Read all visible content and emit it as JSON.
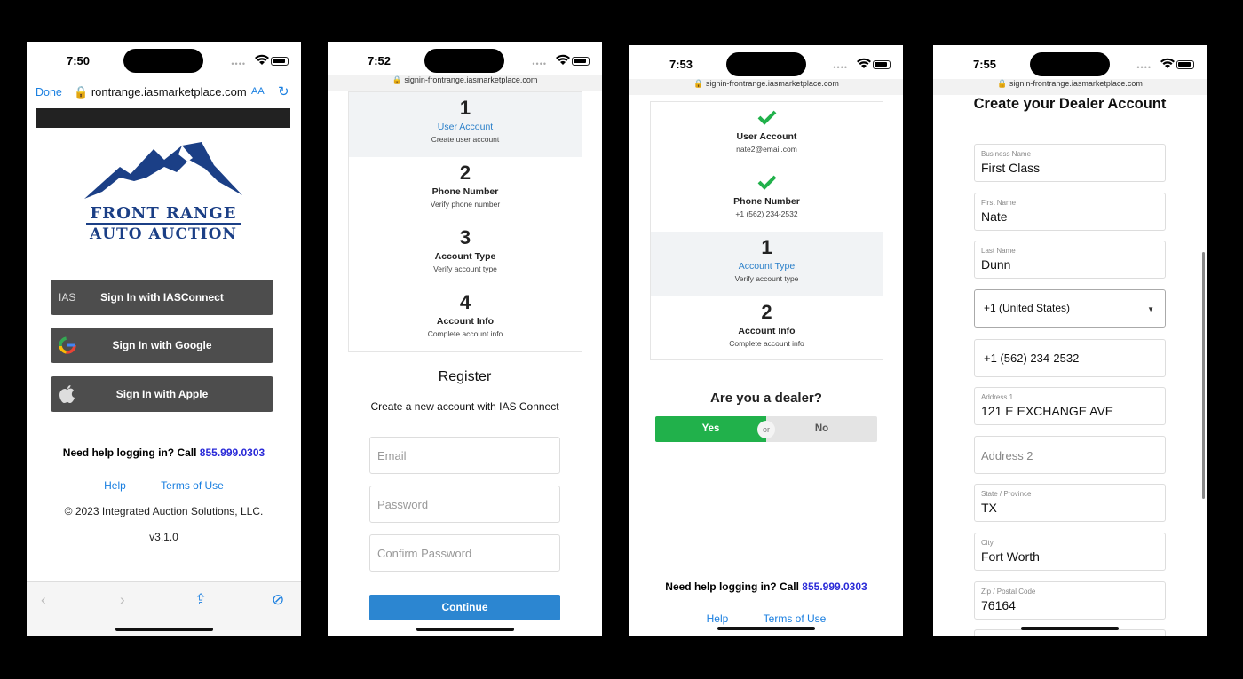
{
  "phone1": {
    "time": "7:50",
    "browser": {
      "done": "Done",
      "url": "rontrange.iasmarketplace.com",
      "aa": "AA"
    },
    "logo": {
      "line1": "FRONT RANGE",
      "line2": "AUTO AUCTION"
    },
    "buttons": [
      {
        "icon_text": "IAS",
        "label": "Sign In with IASConnect"
      },
      {
        "icon": "google-icon",
        "label": "Sign In with Google"
      },
      {
        "icon": "apple-icon",
        "label": "Sign In with Apple"
      }
    ],
    "help_text": "Need help logging in? Call",
    "help_phone": "855.999.0303",
    "link_help": "Help",
    "link_terms": "Terms of Use",
    "copyright": "© 2023 Integrated Auction Solutions, LLC.",
    "version": "v3.1.0"
  },
  "phone2": {
    "time": "7:52",
    "url": "signin-frontrange.iasmarketplace.com",
    "steps": [
      {
        "num": "1",
        "title": "User Account",
        "sub": "Create user account",
        "active": true
      },
      {
        "num": "2",
        "title": "Phone Number",
        "sub": "Verify phone number"
      },
      {
        "num": "3",
        "title": "Account Type",
        "sub": "Verify account type"
      },
      {
        "num": "4",
        "title": "Account Info",
        "sub": "Complete account info"
      }
    ],
    "register_title": "Register",
    "register_sub": "Create a new account with IAS Connect",
    "email_placeholder": "Email",
    "password_placeholder": "Password",
    "confirm_placeholder": "Confirm Password",
    "continue_label": "Continue"
  },
  "phone3": {
    "time": "7:53",
    "url": "signin-frontrange.iasmarketplace.com",
    "steps": [
      {
        "title": "User Account",
        "sub": "nate2@email.com",
        "done": true
      },
      {
        "title": "Phone Number",
        "sub": "+1 (562) 234-2532",
        "done": true
      },
      {
        "num": "1",
        "title": "Account Type",
        "sub": "Verify account type",
        "active": true
      },
      {
        "num": "2",
        "title": "Account Info",
        "sub": "Complete account info"
      }
    ],
    "question": "Are you a dealer?",
    "yes": "Yes",
    "or": "or",
    "no": "No",
    "help_text": "Need help logging in? Call",
    "help_phone": "855.999.0303",
    "link_help": "Help",
    "link_terms": "Terms of Use"
  },
  "phone4": {
    "time": "7:55",
    "url": "signin-frontrange.iasmarketplace.com",
    "title": "Create your Dealer Account",
    "fields": {
      "business_label": "Business Name",
      "business_value": "First Class",
      "first_label": "First Name",
      "first_value": "Nate",
      "last_label": "Last Name",
      "last_value": "Dunn",
      "country_value": "+1 (United States)",
      "phone_value": "+1 (562) 234-2532",
      "address1_label": "Address 1",
      "address1_value": "121 E EXCHANGE AVE",
      "address2_placeholder": "Address 2",
      "state_label": "State / Province",
      "state_value": "TX",
      "city_label": "City",
      "city_value": "Fort Worth",
      "zip_label": "Zip / Postal Code",
      "zip_value": "76164"
    }
  },
  "colors": {
    "accent": "#2c86d1",
    "green": "#21b14b",
    "link": "#1a7fe0",
    "button_dark": "#4d4d4d",
    "logo_blue": "#1b3f86"
  }
}
